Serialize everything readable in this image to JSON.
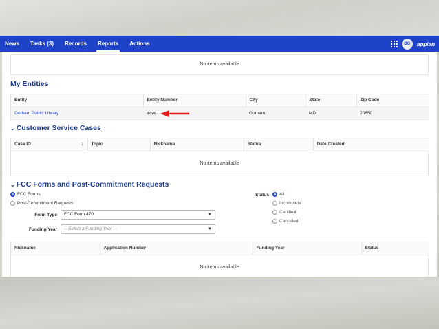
{
  "nav": {
    "items": [
      {
        "label": "News"
      },
      {
        "label": "Tasks (3)"
      },
      {
        "label": "Records"
      },
      {
        "label": "Reports"
      },
      {
        "label": "Actions"
      }
    ],
    "active": "Reports",
    "avatar_initials": "BG",
    "logo": "appian",
    "icons": {
      "apps": "apps-grid-icon"
    }
  },
  "top_panel": {
    "empty_text": "No items available"
  },
  "my_entities": {
    "title": "My Entities",
    "columns": [
      "Entity",
      "Entity Number",
      "City",
      "State",
      "Zip Code"
    ],
    "rows": [
      {
        "entity": "Gotham Public Library",
        "entity_number": "4499",
        "city": "Gotham",
        "state": "MD",
        "zip": "20850"
      }
    ]
  },
  "customer_service": {
    "title": "Customer Service Cases",
    "columns": [
      "Case ID",
      "Topic",
      "Nickname",
      "Status",
      "Date Created"
    ],
    "empty_text": "No items available"
  },
  "fcc": {
    "title": "FCC Forms and Post-Commitment Requests",
    "form_options": [
      "FCC Forms",
      "Post-Commitment Requests"
    ],
    "form_selected": "FCC Forms",
    "form_type_label": "Form Type",
    "form_type_value": "FCC Form 470",
    "funding_year_label": "Funding Year",
    "funding_year_placeholder": "-- Select a Funding Year --",
    "status_label": "Status",
    "status_options": [
      "All",
      "Incomplete",
      "Certified",
      "Canceled"
    ],
    "status_selected": "All",
    "columns": [
      "Nickname",
      "Application Number",
      "Funding Year",
      "Status"
    ],
    "empty_text": "No items available"
  },
  "colors": {
    "nav_bg": "#1f43c8",
    "heading": "#1b3c8c",
    "link": "#1f43c8",
    "arrow": "#e01b1b"
  }
}
